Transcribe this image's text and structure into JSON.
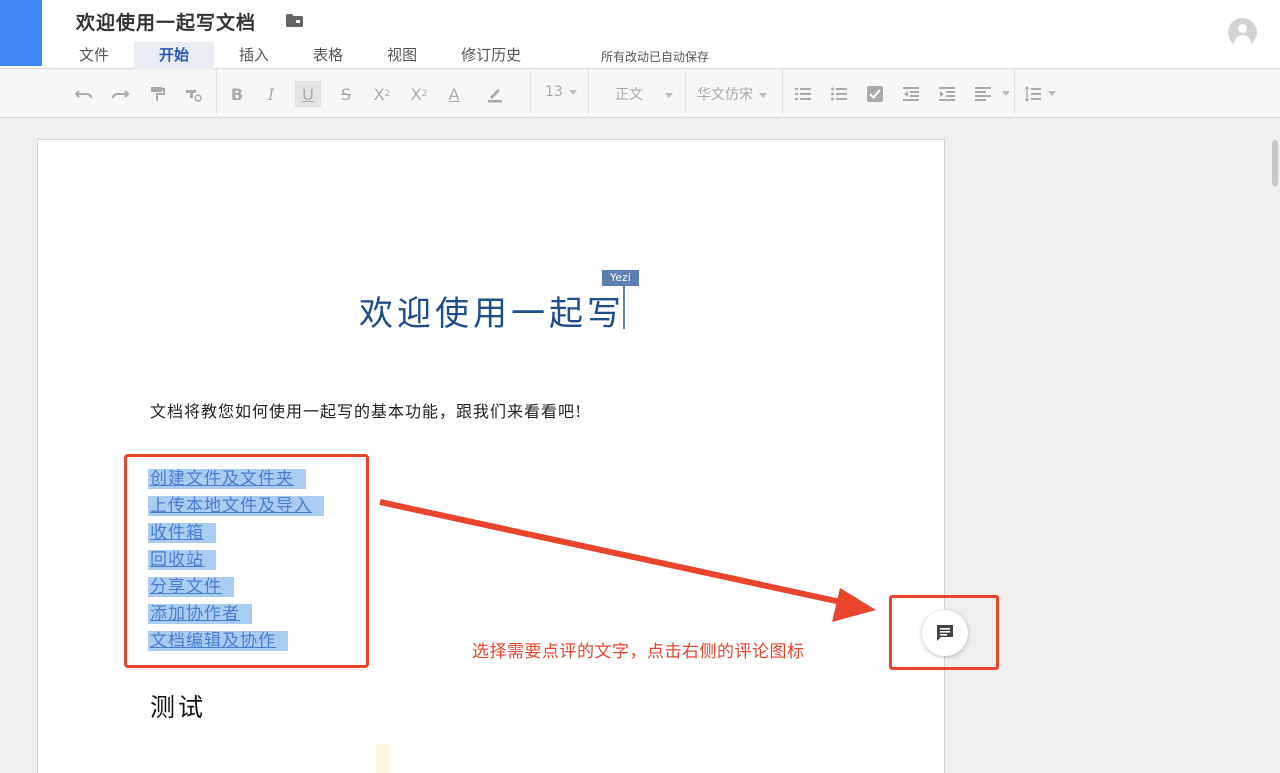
{
  "header": {
    "doc_title": "欢迎使用一起写文档",
    "menu": [
      {
        "label": "文件"
      },
      {
        "label": "开始"
      },
      {
        "label": "插入"
      },
      {
        "label": "表格"
      },
      {
        "label": "视图"
      },
      {
        "label": "修订历史"
      }
    ],
    "active_menu": "开始",
    "autosave": "所有改动已自动保存"
  },
  "toolbar": {
    "font_size": "13",
    "paragraph_style": "正文",
    "font_family": "华文仿宋",
    "icons": [
      "undo-icon",
      "redo-icon",
      "format-painter-icon",
      "clear-format-icon",
      "bold-icon",
      "italic-icon",
      "underline-icon",
      "strikethrough-icon",
      "superscript-icon",
      "subscript-icon",
      "text-color-icon",
      "highlight-icon",
      "numbered-list-icon",
      "bullet-list-icon",
      "checklist-icon",
      "outdent-icon",
      "indent-icon",
      "align-icon",
      "line-spacing-icon"
    ]
  },
  "document": {
    "heading": "欢迎使用一起写",
    "collaborator_cursor": "Yezi",
    "intro": "文档将教您如何使用一起写的基本功能，跟我们来看看吧!",
    "links": [
      {
        "label": "创建文件及文件夹"
      },
      {
        "label": "上传本地文件及导入"
      },
      {
        "label": "收件箱"
      },
      {
        "label": "回收站"
      },
      {
        "label": "分享文件"
      },
      {
        "label": "添加协作者"
      },
      {
        "label": "文档编辑及协作"
      }
    ],
    "subheading": "测试"
  },
  "annotation": {
    "text": "选择需要点评的文字，点击右侧的评论图标",
    "color": "#e8452c"
  },
  "colors": {
    "brand": "#4285f4",
    "heading": "#1f4e8c",
    "selection": "#a9cdf0",
    "link": "#4a7fd0"
  }
}
